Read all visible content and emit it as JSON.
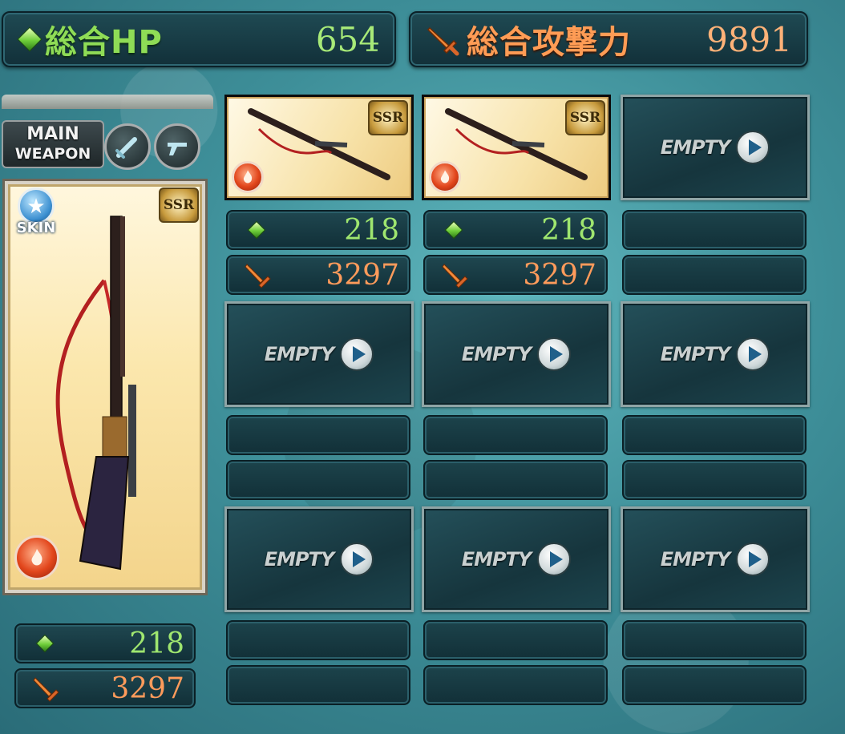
{
  "totals": {
    "hp_label": "総合HP",
    "hp_value": "654",
    "atk_label": "総合攻撃力",
    "atk_value": "9891"
  },
  "main_weapon": {
    "header_line1": "MAIN",
    "header_line2": "WEAPON",
    "rarity": "SSR",
    "skin_label": "SKIN",
    "element": "fire",
    "hp": "218",
    "atk": "3297"
  },
  "grid": {
    "empty_label": "EMPTY",
    "slots": [
      {
        "state": "filled",
        "rarity": "SSR",
        "element": "fire",
        "hp": "218",
        "atk": "3297"
      },
      {
        "state": "filled",
        "rarity": "SSR",
        "element": "fire",
        "hp": "218",
        "atk": "3297"
      },
      {
        "state": "empty"
      },
      {
        "state": "empty"
      },
      {
        "state": "empty"
      },
      {
        "state": "empty"
      },
      {
        "state": "empty"
      },
      {
        "state": "empty"
      },
      {
        "state": "empty"
      }
    ]
  },
  "colors": {
    "hp_green": "#8fdc56",
    "atk_orange": "#ff9c55",
    "panel_dark": "#123039",
    "background_teal": "#3e8f99"
  }
}
